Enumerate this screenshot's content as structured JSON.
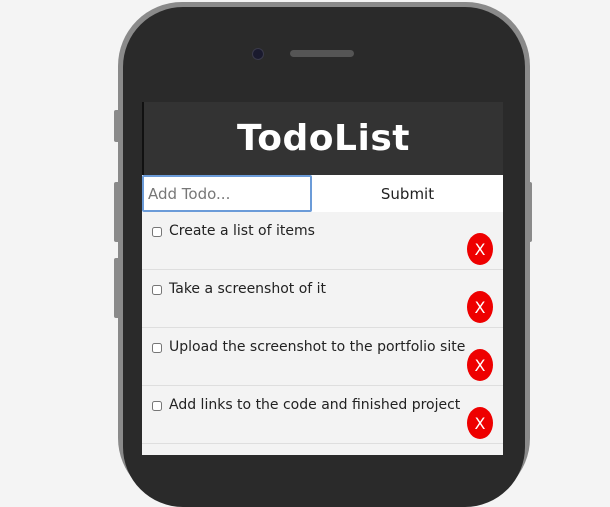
{
  "app": {
    "title": "TodoList"
  },
  "form": {
    "input_placeholder": "Add Todo...",
    "input_value": "",
    "submit_label": "Submit"
  },
  "todos": [
    {
      "text": "Create a list of items",
      "checked": false,
      "delete_label": "X"
    },
    {
      "text": "Take a screenshot of it",
      "checked": false,
      "delete_label": "X"
    },
    {
      "text": "Upload the screenshot to the portfolio site",
      "checked": false,
      "delete_label": "X"
    },
    {
      "text": "Add links to the code and finished project",
      "checked": false,
      "delete_label": "X"
    }
  ],
  "colors": {
    "header_bg": "#333333",
    "delete_button": "#ee0000",
    "input_focus_border": "#6b9bd8",
    "phone_body": "#2a2a2a",
    "phone_frame": "#8a8a8a"
  },
  "icons": {
    "delete": "x-icon"
  }
}
